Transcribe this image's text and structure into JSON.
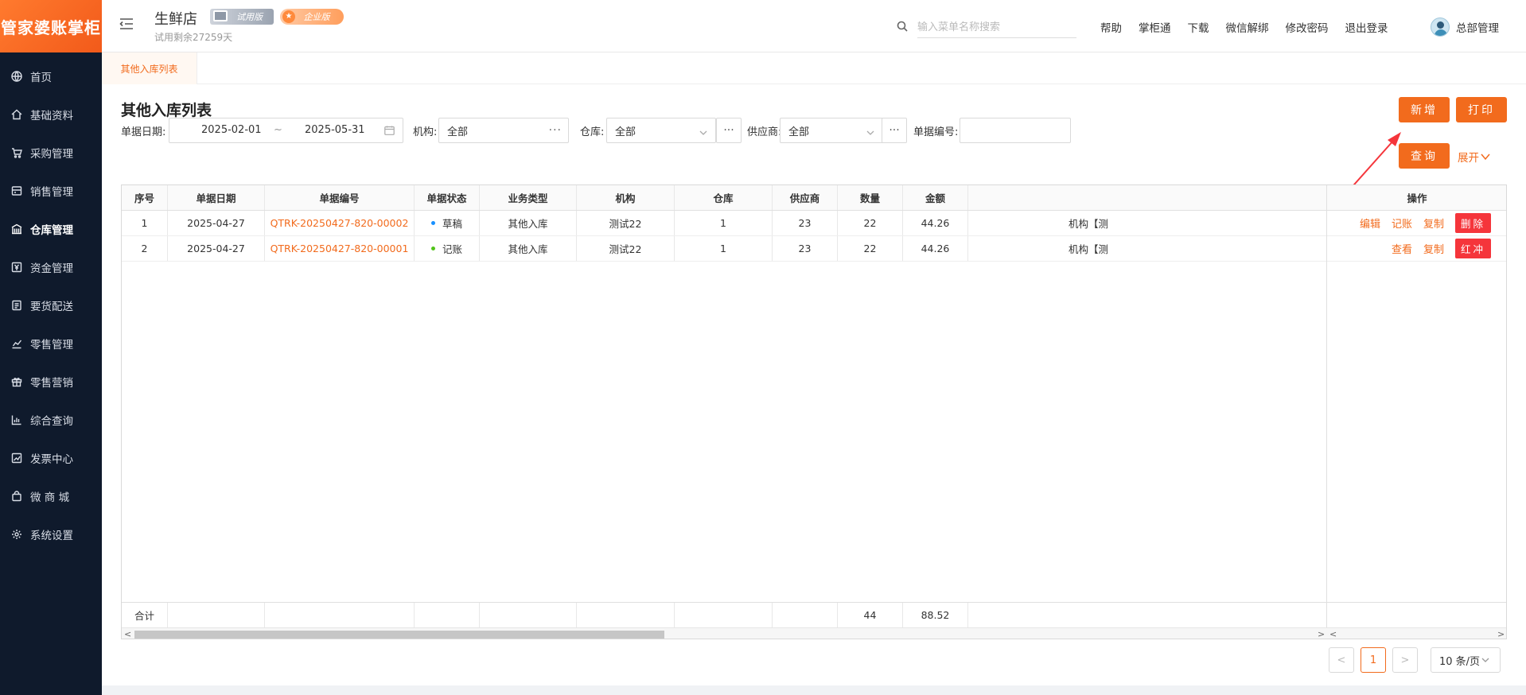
{
  "app": {
    "logo": "管家婆账掌柜",
    "store_name": "生鲜店",
    "badge_trial": "试用版",
    "badge_enterprise": "企业版",
    "trial_remaining": "试用剩余27259天",
    "search_placeholder": "输入菜单名称搜索",
    "top_links": [
      "帮助",
      "掌柜通",
      "下载",
      "微信解绑",
      "修改密码",
      "退出登录"
    ],
    "user_name": "总部管理",
    "accent_color": "#f26b1d"
  },
  "sidebar": {
    "items": [
      {
        "label": "首页",
        "icon": "globe-icon"
      },
      {
        "label": "基础资料",
        "icon": "home-icon"
      },
      {
        "label": "采购管理",
        "icon": "cart-icon"
      },
      {
        "label": "销售管理",
        "icon": "register-icon"
      },
      {
        "label": "仓库管理",
        "icon": "warehouse-icon",
        "active": true
      },
      {
        "label": "资金管理",
        "icon": "money-icon"
      },
      {
        "label": "要货配送",
        "icon": "document-icon"
      },
      {
        "label": "零售管理",
        "icon": "chart-icon"
      },
      {
        "label": "零售营销",
        "icon": "gift-icon"
      },
      {
        "label": "综合查询",
        "icon": "bar-chart-icon"
      },
      {
        "label": "发票中心",
        "icon": "trend-icon"
      },
      {
        "label": "微 商 城",
        "icon": "bag-icon"
      },
      {
        "label": "系统设置",
        "icon": "gear-icon"
      }
    ]
  },
  "tabs": [
    {
      "label": "其他入库列表"
    }
  ],
  "page": {
    "title": "其他入库列表",
    "btn_add": "新增",
    "btn_print": "打印",
    "btn_query": "查询",
    "expand": "展开"
  },
  "filters": {
    "date_label": "单据日期:",
    "date_start": "2025-02-01",
    "date_sep": "~",
    "date_end": "2025-05-31",
    "org_label": "机构:",
    "org_value": "全部",
    "warehouse_label": "仓库:",
    "warehouse_value": "全部",
    "supplier_label": "供应商:",
    "supplier_value": "全部",
    "docno_label": "单据编号:",
    "docno_value": ""
  },
  "table": {
    "headers": [
      "序号",
      "单据日期",
      "单据编号",
      "单据状态",
      "业务类型",
      "机构",
      "仓库",
      "供应商",
      "数量",
      "金额",
      "",
      "操作"
    ],
    "rows": [
      {
        "index": "1",
        "date": "2025-04-27",
        "doc_no": "QTRK-20250427-820-00002",
        "status": "草稿",
        "status_color": "#1890ff",
        "biz_type": "其他入库",
        "org": "测试22",
        "warehouse": "1",
        "supplier": "23",
        "qty": "22",
        "amount": "44.26",
        "remark": "机构【测",
        "actions": [
          "编辑",
          "记账",
          "复制"
        ],
        "danger_action": "删除"
      },
      {
        "index": "2",
        "date": "2025-04-27",
        "doc_no": "QTRK-20250427-820-00001",
        "status": "记账",
        "status_color": "#52c41a",
        "biz_type": "其他入库",
        "org": "测试22",
        "warehouse": "1",
        "supplier": "23",
        "qty": "22",
        "amount": "44.26",
        "remark": "机构【测",
        "actions": [
          "查看",
          "复制"
        ],
        "danger_action": "红冲"
      }
    ],
    "footer": {
      "label": "合计",
      "qty": "44",
      "amount": "88.52"
    }
  },
  "pagination": {
    "prev": "<",
    "current": "1",
    "next": ">",
    "page_size": "10 条/页"
  }
}
